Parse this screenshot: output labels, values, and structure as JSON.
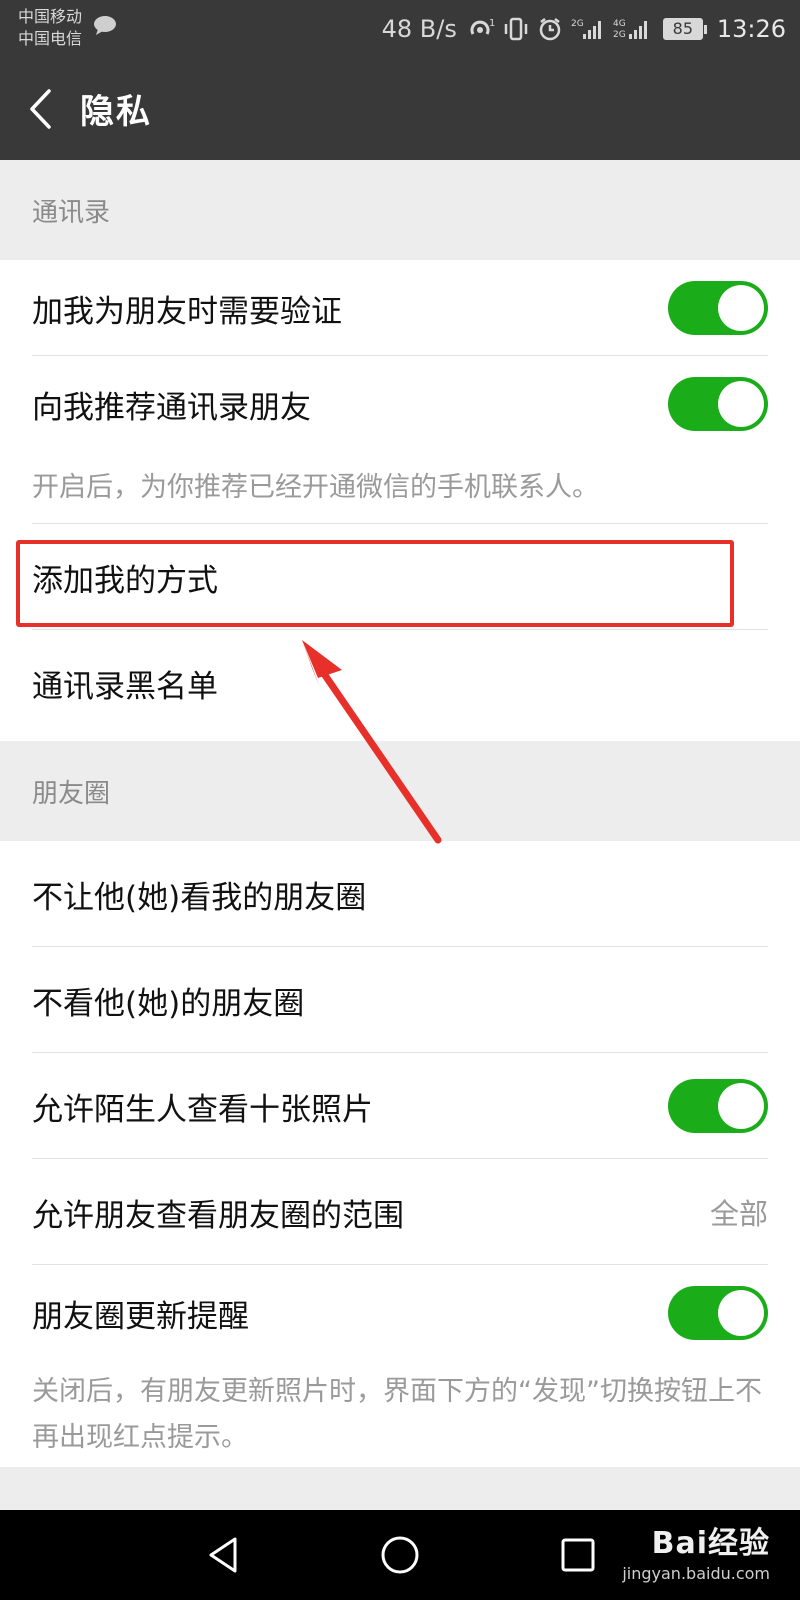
{
  "status_bar": {
    "carrier_1": "中国移动",
    "carrier_2": "中国电信",
    "net_speed": "48 B/s",
    "battery": "85",
    "time": "13:26",
    "icons": [
      "chat-icon",
      "hotspot-icon",
      "vibrate-icon",
      "alarm-icon",
      "signal-2g-icon",
      "signal-4g-icon",
      "battery-icon"
    ]
  },
  "header": {
    "title": "隐私",
    "back_icon": "chevron-left-icon"
  },
  "contacts_section": {
    "header": "通讯录",
    "rows": [
      {
        "label": "加我为朋友时需要验证",
        "toggle_on": true
      },
      {
        "label": "向我推荐通讯录朋友",
        "toggle_on": true
      },
      {
        "label": "添加我的方式"
      },
      {
        "label": "通讯录黑名单"
      }
    ],
    "recommend_note": "开启后，为你推荐已经开通微信的手机联系人。"
  },
  "moments_section": {
    "header": "朋友圈",
    "rows": [
      {
        "label": "不让他(她)看我的朋友圈"
      },
      {
        "label": "不看他(她)的朋友圈"
      },
      {
        "label": "允许陌生人查看十张照片",
        "toggle_on": true
      },
      {
        "label": "允许朋友查看朋友圈的范围",
        "value": "全部"
      },
      {
        "label": "朋友圈更新提醒",
        "toggle_on": true
      }
    ],
    "update_note": "关闭后，有朋友更新照片时，界面下方的“发现”切换按钮上不再出现红点提示。"
  },
  "colors": {
    "toolbar": "#393939",
    "toggle_on": "#1aad19",
    "annotation": "#e8302a",
    "background": "#ededed"
  },
  "nav_bar": {
    "icons": [
      "back-triangle-icon",
      "home-circle-icon",
      "recents-square-icon"
    ]
  },
  "watermark": {
    "main": "Bai经验",
    "sub": "jingyan.baidu.com"
  }
}
